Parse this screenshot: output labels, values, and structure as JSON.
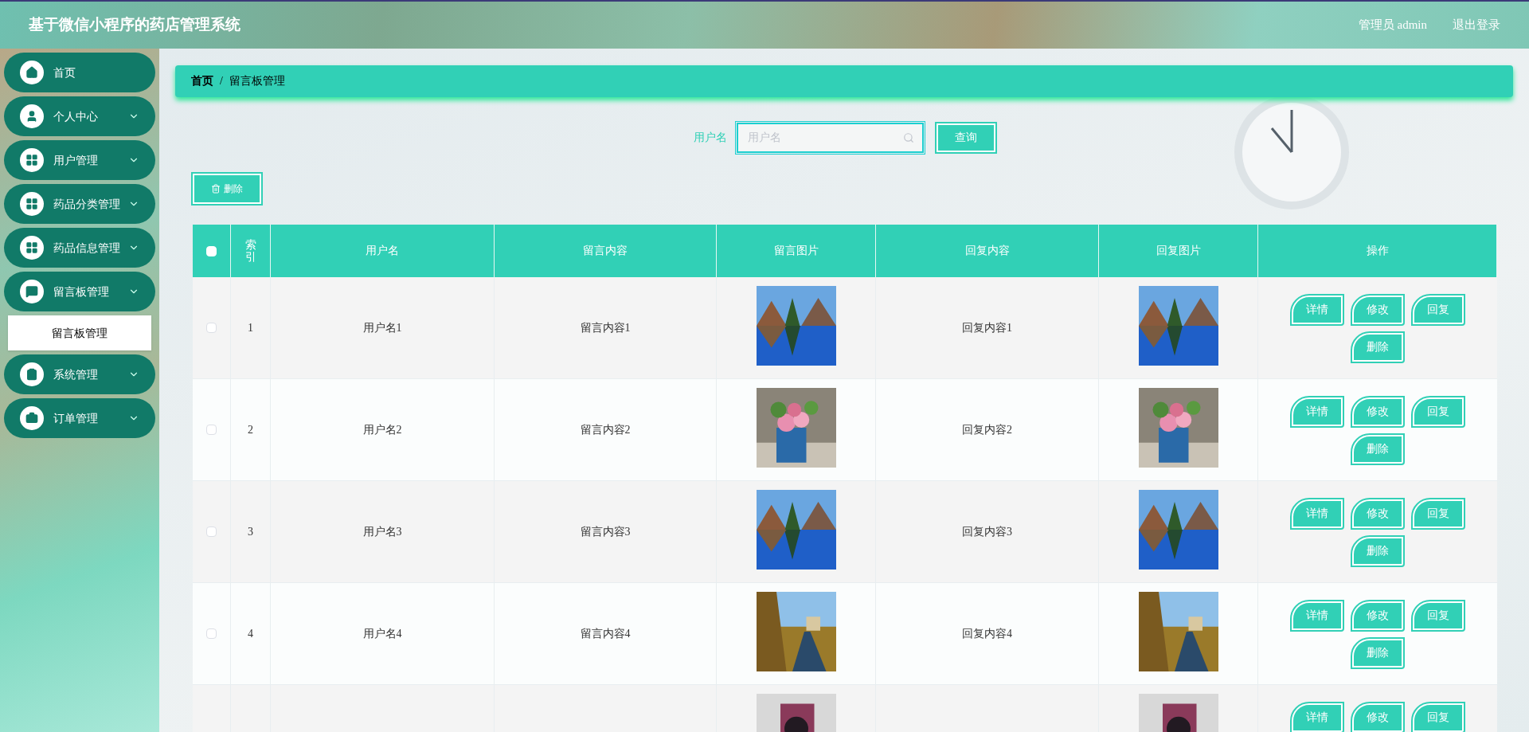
{
  "header": {
    "title": "基于微信小程序的药店管理系统",
    "user_label": "管理员 admin",
    "logout": "退出登录"
  },
  "sidebar": {
    "items": [
      {
        "label": "首页",
        "expandable": false,
        "expanded": false
      },
      {
        "label": "个人中心",
        "expandable": true,
        "expanded": false
      },
      {
        "label": "用户管理",
        "expandable": true,
        "expanded": false
      },
      {
        "label": "药品分类管理",
        "expandable": true,
        "expanded": false
      },
      {
        "label": "药品信息管理",
        "expandable": true,
        "expanded": false
      },
      {
        "label": "留言板管理",
        "expandable": true,
        "expanded": true,
        "children": [
          {
            "label": "留言板管理",
            "selected": true
          }
        ]
      },
      {
        "label": "系统管理",
        "expandable": true,
        "expanded": false
      },
      {
        "label": "订单管理",
        "expandable": true,
        "expanded": false
      }
    ]
  },
  "breadcrumb": [
    "首页",
    "/",
    "留言板管理"
  ],
  "search": {
    "label": "用户名",
    "placeholder": "用户名",
    "button": "查询"
  },
  "delete_button": "删除",
  "table": {
    "select_all_checked": false,
    "columns": [
      "索引",
      "用户名",
      "留言内容",
      "留言图片",
      "回复内容",
      "回复图片",
      "操作"
    ],
    "rows": [
      {
        "checked": false,
        "index": "1",
        "username": "用户名1",
        "content": "留言内容1",
        "image": {
          "kind": "picture"
        },
        "reply": "回复内容1",
        "reply_image": {
          "kind": "picture"
        },
        "actions": [
          "详情",
          "修改",
          "回复",
          "删除"
        ]
      },
      {
        "checked": false,
        "index": "2",
        "username": "用户名2",
        "content": "留言内容2",
        "image": {
          "kind": "picture"
        },
        "reply": "回复内容2",
        "reply_image": {
          "kind": "picture"
        },
        "actions": [
          "详情",
          "修改",
          "回复",
          "删除"
        ]
      },
      {
        "checked": false,
        "index": "3",
        "username": "用户名3",
        "content": "留言内容3",
        "image": {
          "kind": "picture"
        },
        "reply": "回复内容3",
        "reply_image": {
          "kind": "picture"
        },
        "actions": [
          "详情",
          "修改",
          "回复",
          "删除"
        ]
      },
      {
        "checked": false,
        "index": "4",
        "username": "用户名4",
        "content": "留言内容4",
        "image": {
          "kind": "picture"
        },
        "reply": "回复内容4",
        "reply_image": {
          "kind": "picture"
        },
        "actions": [
          "详情",
          "修改",
          "回复",
          "删除"
        ]
      },
      {
        "image": {
          "kind": "picture"
        },
        "reply_image": {
          "kind": "picture"
        },
        "actions": [
          "详情",
          "修改",
          "回复"
        ]
      }
    ]
  }
}
